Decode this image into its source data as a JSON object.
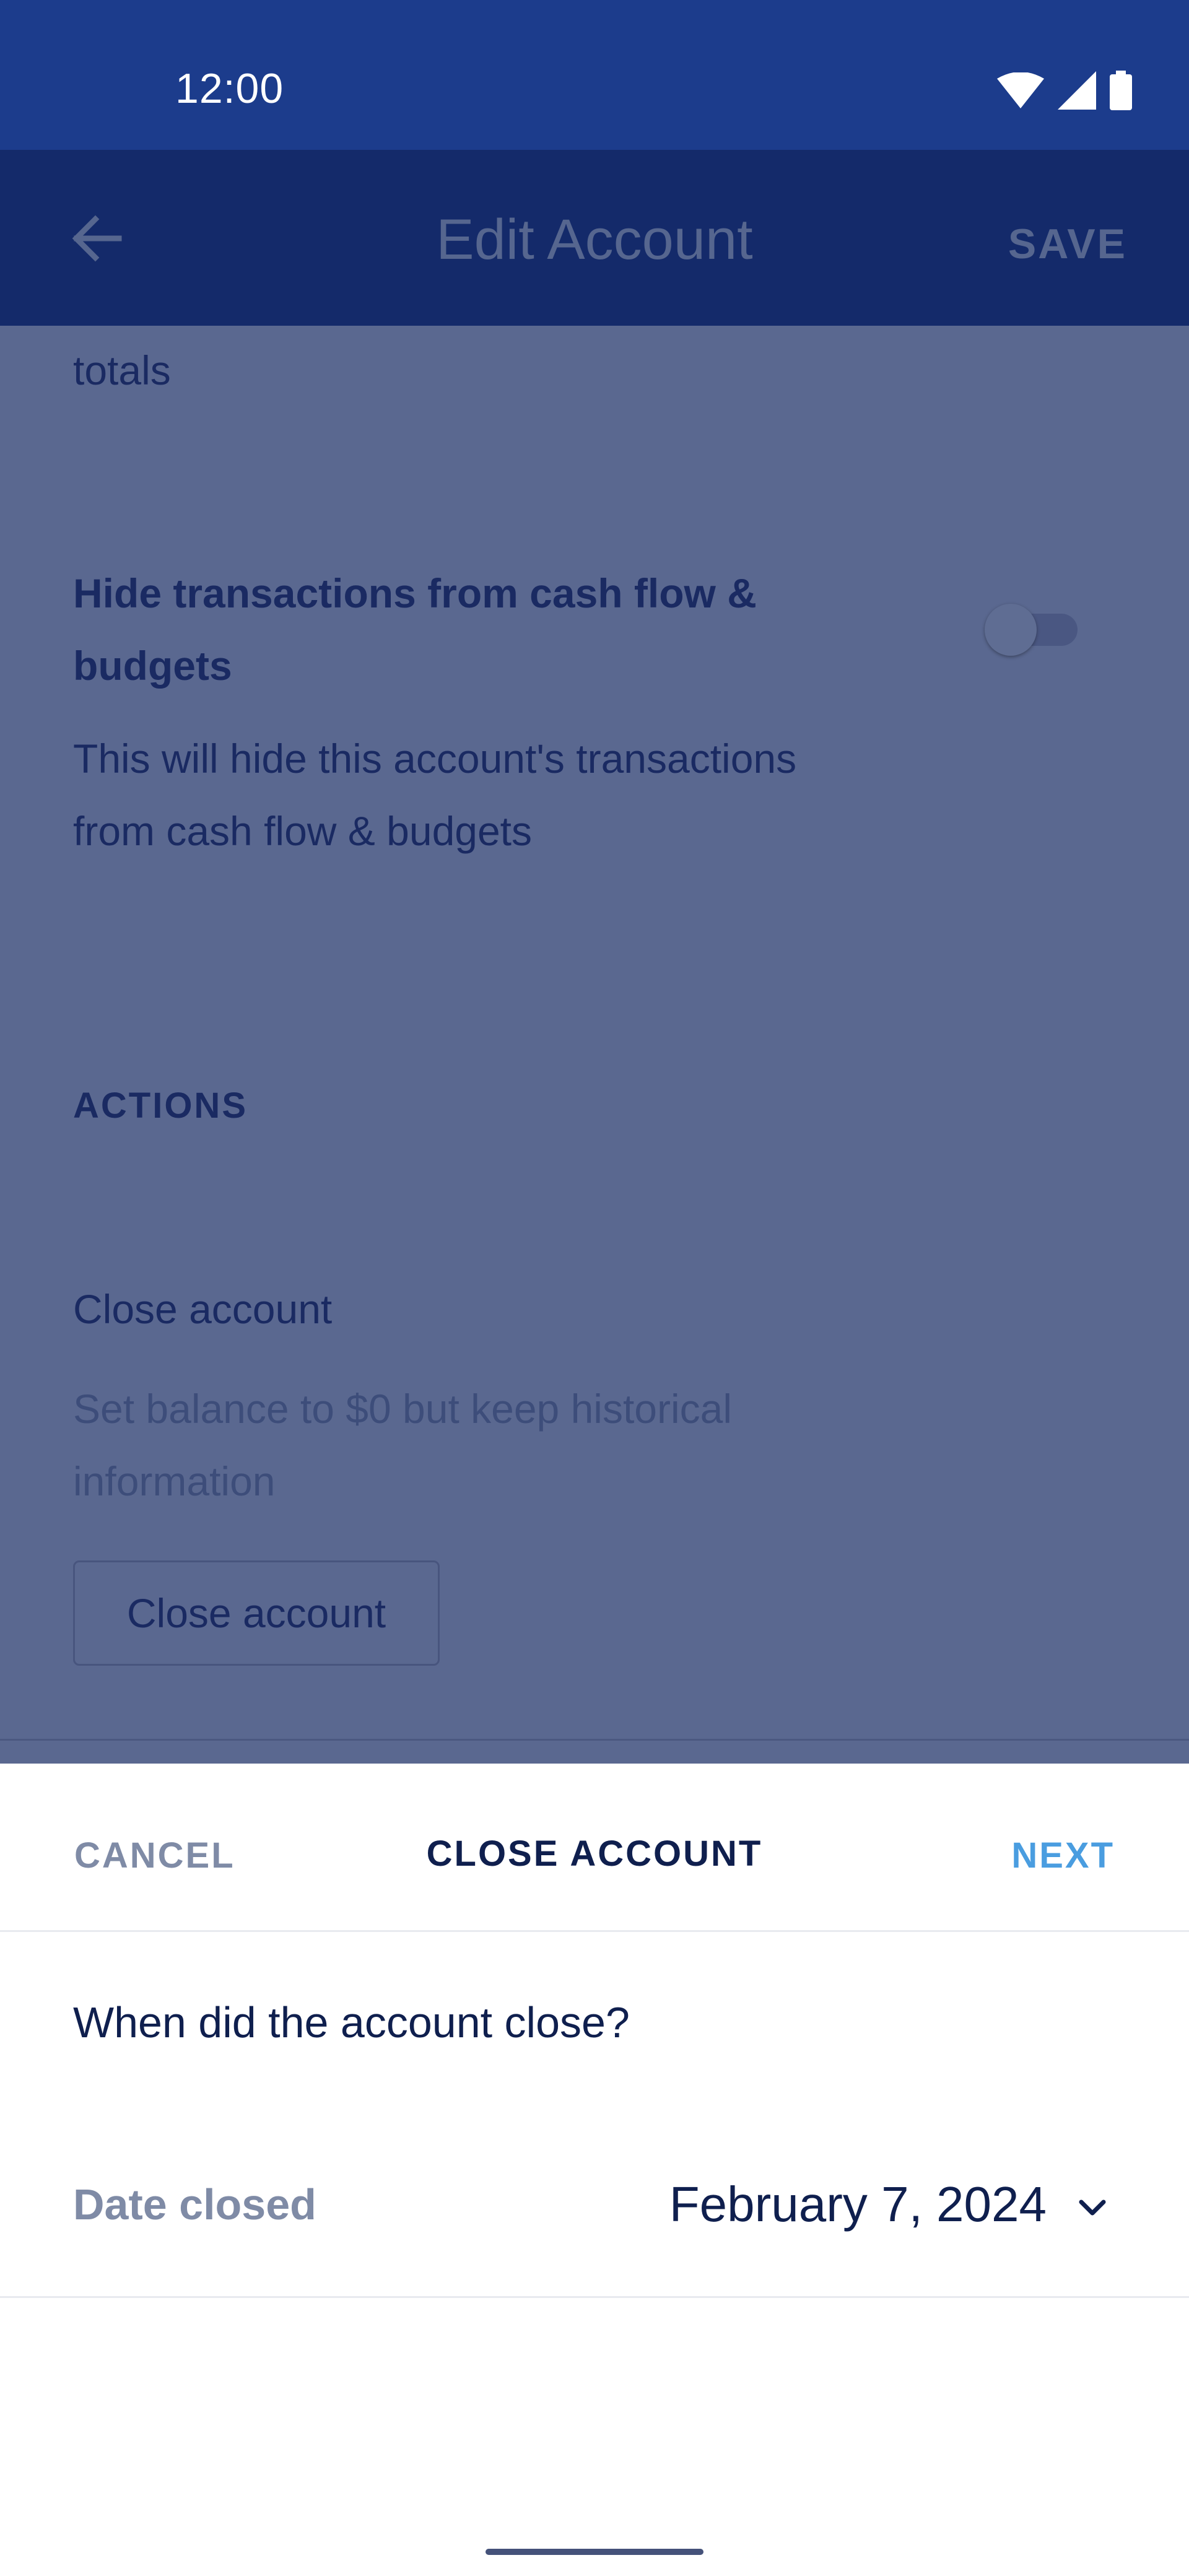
{
  "status_bar": {
    "time": "12:00",
    "icons": [
      "wifi-icon",
      "cellular-signal-icon",
      "battery-icon"
    ]
  },
  "app_bar": {
    "back_icon": "arrow-left-icon",
    "title": "Edit Account",
    "save_label": "SAVE"
  },
  "content": {
    "totals_fragment": "totals",
    "hide_transactions": {
      "title": "Hide transactions from cash flow & budgets",
      "description": "This will hide this account's transactions from cash flow & budgets",
      "toggle_on": false
    },
    "actions_header": "ACTIONS",
    "close_account": {
      "title": "Close account",
      "description": "Set balance to $0 but keep historical information",
      "button_label": "Close account"
    }
  },
  "sheet": {
    "cancel_label": "CANCEL",
    "title": "CLOSE ACCOUNT",
    "next_label": "NEXT",
    "question": "When did the account close?",
    "date_label": "Date closed",
    "date_value": "February 7, 2024",
    "date_icon": "chevron-down-icon"
  },
  "colors": {
    "status_bar": "#1c3c8c",
    "app_bar": "#142a6a",
    "overlay_content": "#5a6890",
    "accent": "#4a9de0",
    "text_primary": "#0f1f4e",
    "text_secondary": "#7f8ba6"
  }
}
